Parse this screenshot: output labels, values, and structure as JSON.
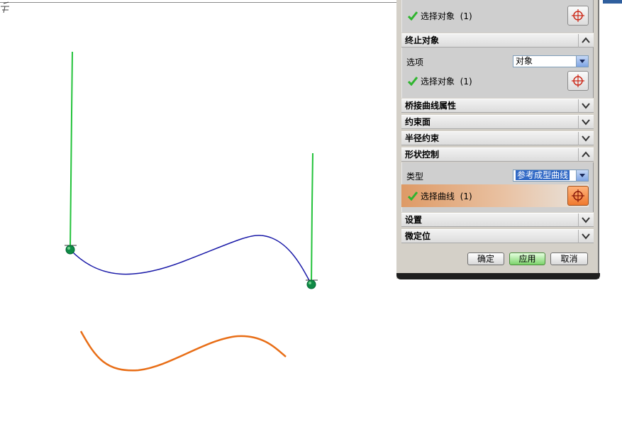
{
  "dialog": {
    "start_section": {
      "select_label": "选择对象",
      "count": "(1)"
    },
    "end_object": {
      "title": "终止对象",
      "option_label": "选项",
      "option_value": "对象",
      "select_label": "选择对象",
      "count": "(1)"
    },
    "collapsed_sections": [
      "桥接曲线属性",
      "约束面",
      "半径约束"
    ],
    "shape_control": {
      "title": "形状控制",
      "type_label": "类型",
      "type_value": "参考成型曲线",
      "select_label": "选择曲线",
      "count": "(1)"
    },
    "settings": "设置",
    "fine_position": "微定位",
    "buttons": {
      "ok": "确定",
      "apply": "应用",
      "cancel": "取消"
    }
  },
  "colors": {
    "reference_curve": "#e86e17",
    "bridge_curve": "#1a1aa8",
    "guide_lines": "#22c23a",
    "check": "#2fb52f",
    "target": "#cc2a1a"
  },
  "icons": [
    "check-icon",
    "target-icon",
    "chevron-up-icon",
    "chevron-down-icon"
  ]
}
